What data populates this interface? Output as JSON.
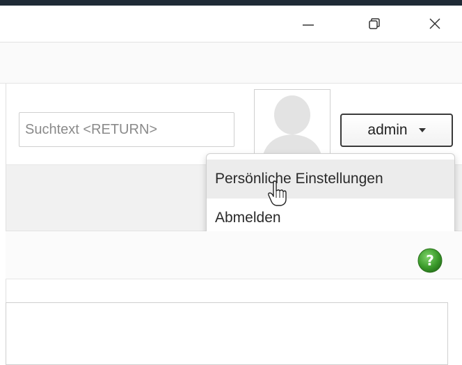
{
  "window": {
    "controls": {
      "minimize_icon": "minimize-icon",
      "maximize_icon": "maximize-icon",
      "close_icon": "close-icon"
    }
  },
  "header": {
    "search": {
      "placeholder": "Suchtext <RETURN>",
      "value": ""
    },
    "avatar_icon": "person-silhouette-icon",
    "user_menu": {
      "label": "admin",
      "icon": "chevron-down-icon"
    }
  },
  "dropdown": {
    "items": [
      {
        "label": "Persönliche Einstellungen",
        "hovered": true
      },
      {
        "label": "Abmelden",
        "hovered": false
      }
    ]
  },
  "content": {
    "help_icon": "question-mark-icon"
  },
  "colors": {
    "title_bar_dark": "#1f2a36",
    "help_green": "#3a9a2a",
    "hover_background": "#ececec"
  }
}
